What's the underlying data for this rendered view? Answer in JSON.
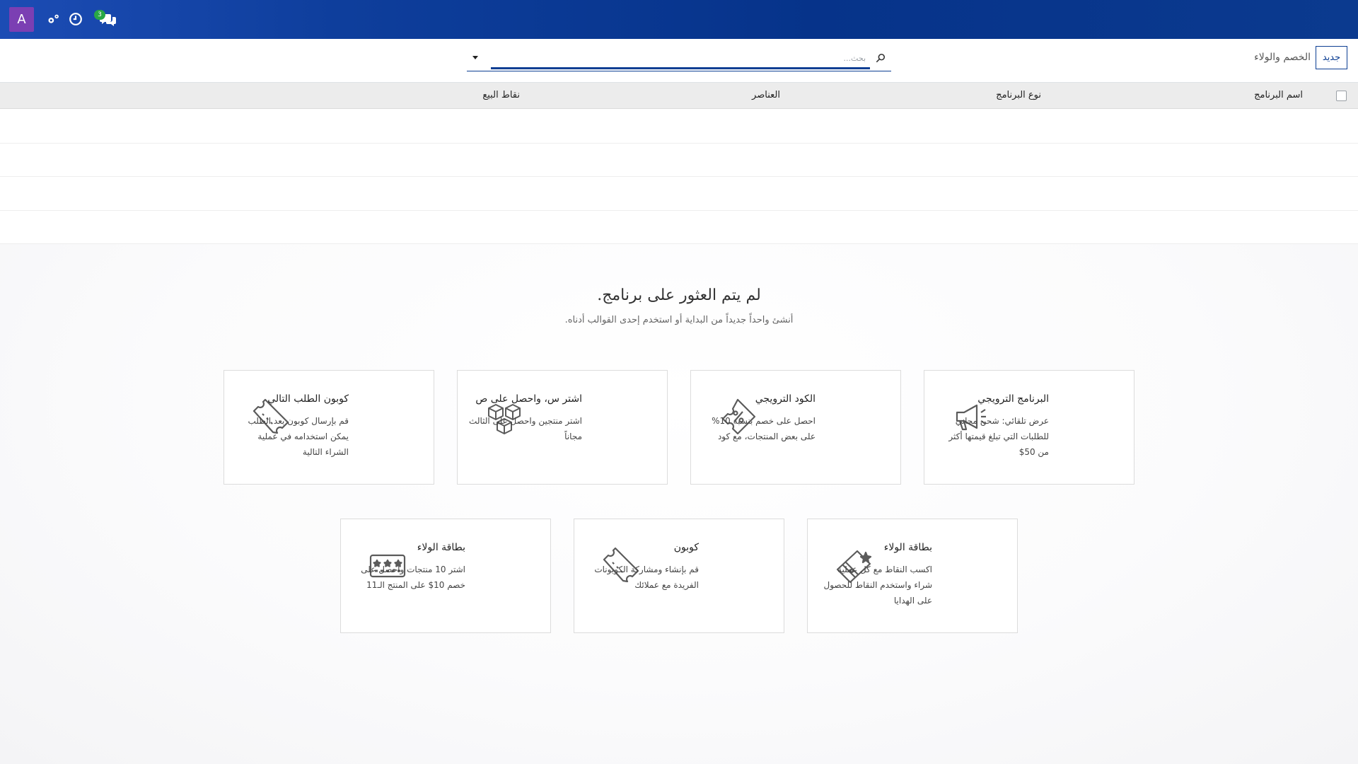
{
  "navbar": {
    "avatar_letter": "A",
    "chat_badge_count": "3",
    "icons": [
      "settings-icon",
      "clock-icon",
      "chat-icon"
    ]
  },
  "control_panel": {
    "breadcrumb": "الخصم والولاء",
    "new_button_label": "جديد",
    "search_placeholder": "بحث..."
  },
  "list_header": {
    "columns": [
      "اسم البرنامج",
      "نوع البرنامج",
      "العناصر",
      "نقاط البيع"
    ]
  },
  "helper": {
    "title": "لم يتم العثور على برنامج.",
    "subtitle": "أنشئ واحداً جديداً من البداية أو استخدم إحدى القوالب أدناه.",
    "templates": [
      {
        "title": "البرنامج الترويجي",
        "desc": "عرض تلقائي: شحن مجاني للطلبات التي تبلغ قيمتها أكثر من 50$",
        "icon": "megaphone-icon"
      },
      {
        "title": "الكود الترويجي",
        "desc": "احصل على خصم بنسبة 10% على بعض المنتجات، مع كود",
        "icon": "promo-code-icon"
      },
      {
        "title": "اشتر س، واحصل على ص",
        "desc": "اشتر منتجين واحصل على الثالث مجاناً",
        "icon": "boxes-icon"
      },
      {
        "title": "كوبون الطلب التالي",
        "desc": "قم بإرسال كوبون بعد الطلب يمكن استخدامه في عملية الشراء التالية",
        "icon": "ticket-icon"
      },
      {
        "title": "بطاقة الولاء",
        "desc": "اكسب النقاط مع كل عملية شراء واستخدم النقاط للحصول على الهدايا",
        "icon": "loyalty-card-icon"
      },
      {
        "title": "كوبون",
        "desc": "قم بإنشاء ومشاركة الكوبونات الفريدة مع عملائك",
        "icon": "coupon-icon"
      },
      {
        "title": "بطاقة الولاء",
        "desc": "اشتر 10 منتجات واحصل على خصم 10$ على المنتج الـ11",
        "icon": "stamp-card-icon"
      }
    ]
  }
}
